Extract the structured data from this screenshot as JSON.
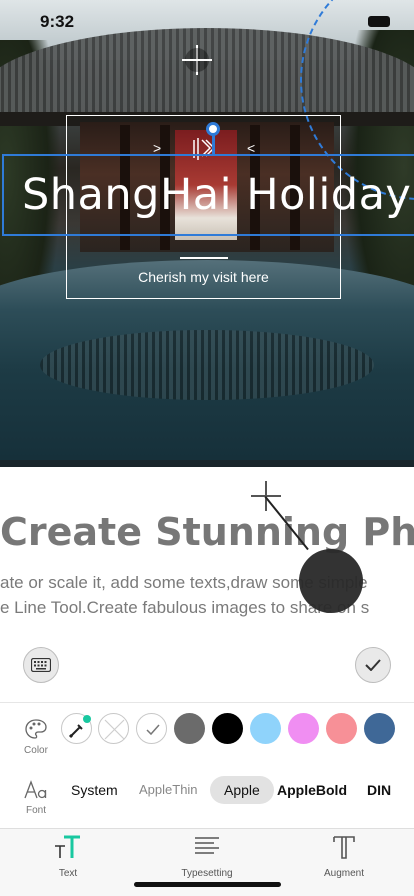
{
  "status_bar": {
    "time": "9:32"
  },
  "canvas": {
    "title": "ShangHai Holiday",
    "subtitle": "Cherish my visit here"
  },
  "promo": {
    "headline": "Create Stunning Photo",
    "line1": "ate or scale it, add some texts,draw some simple",
    "line2": "e Line Tool.Create fabulous images to share on s"
  },
  "editor": {
    "color_label": "Color",
    "font_label": "Font",
    "colors": [
      "#6b6b6b",
      "#000000",
      "#8fd3fb",
      "#f08ef2",
      "#f79097",
      "#3f6897"
    ],
    "fonts": [
      {
        "label": "System",
        "selected": false
      },
      {
        "label": "AppleThin",
        "selected": false
      },
      {
        "label": "Apple",
        "selected": true
      },
      {
        "label": "AppleBold",
        "selected": false
      },
      {
        "label": "DIN",
        "selected": false
      }
    ]
  },
  "tabs": [
    {
      "label": "Text",
      "icon": "text-icon",
      "active": true
    },
    {
      "label": "Typesetting",
      "icon": "typesetting-icon",
      "active": false
    },
    {
      "label": "Augment",
      "icon": "augment-icon",
      "active": false
    }
  ],
  "accent_color": "#2f7bd8",
  "active_tab_color": "#19c8a0"
}
